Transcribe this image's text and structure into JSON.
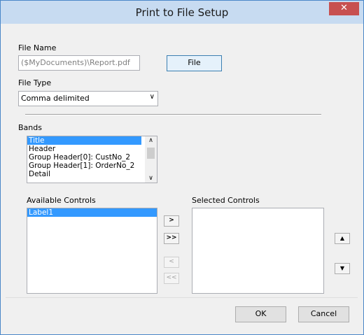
{
  "window": {
    "title": "Print to File Setup",
    "close_glyph": "✕"
  },
  "file_name": {
    "label": "File Name",
    "value": "($MyDocuments)\\Report.pdf",
    "button": "File"
  },
  "file_type": {
    "label": "File Type",
    "value": "Comma delimited"
  },
  "bands": {
    "label": "Bands",
    "items": [
      "Title",
      "Header",
      "Group Header[0]: CustNo_2",
      "Group Header[1]: OrderNo_2",
      "Detail"
    ]
  },
  "available": {
    "label": "Available Controls",
    "items": [
      "Label1"
    ]
  },
  "selected": {
    "label": "Selected Controls"
  },
  "move": {
    "add": ">",
    "add_all": ">>",
    "remove": "<",
    "remove_all": "<<"
  },
  "order": {
    "up": "▲",
    "down": "▼"
  },
  "footer": {
    "ok": "OK",
    "cancel": "Cancel"
  }
}
